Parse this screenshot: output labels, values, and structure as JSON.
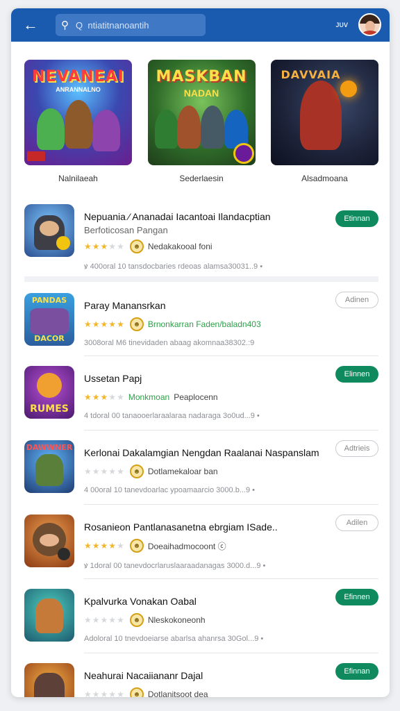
{
  "header": {
    "search_placeholder": "Q  ntiatitnanoantih",
    "user_label": "ᴊᴜᴠ",
    "colors": {
      "bar": "#1a5bb0",
      "search": "#3f78c4"
    }
  },
  "featured": [
    {
      "label": "Nalnilaeah",
      "logo": "NEVANEAI",
      "subtitle": "ANRANNALNO",
      "theme": "fantasy"
    },
    {
      "label": "Sederlaesin",
      "logo": "MASKBAN",
      "subtitle": "NADAN",
      "theme": "heroes"
    },
    {
      "label": "Alsadmoana",
      "logo": "DAVVAIA",
      "subtitle": "",
      "theme": "warrior"
    }
  ],
  "apps": [
    {
      "title": "Nepuania ⁄ Ananadai Iacantoai Ilandacptian",
      "subtitle": "Berfoticosan Pangan",
      "rating": 3,
      "developer": "Nedakakooal foni",
      "dev_color": "default",
      "info": "ꝟ 400oral 10 tansdocbaries rdeoas alamsa30031..9  •",
      "button": "Etinnan",
      "button_style": "filled"
    },
    {
      "title": "Paray Manansrkan",
      "subtitle": "",
      "rating": 5,
      "developer": "Brnonkarran Faden/baladn403",
      "dev_color": "green",
      "info": "3008oral M6 tinevidaden abaag akomnaa38302.:9",
      "button": "Adinen",
      "button_style": "outline"
    },
    {
      "title": "Ussetan Papj",
      "subtitle": "",
      "rating": 3,
      "developer": "Monkmoan",
      "dev_color": "green",
      "developer_extra": "Peaplocenn",
      "info": "4 tdoral 00 tanaooerlaraalaraa nadaraga 3o0ud...9  •",
      "button": "Elinnen",
      "button_style": "filled"
    },
    {
      "title": "Kerlonai Dakalamgian Nengdan Raalanai Naspanslam",
      "subtitle": "",
      "rating": 0,
      "developer": "Dotlamekaloar ban",
      "dev_color": "default",
      "info": "4 00oral 10 tanevdoarlac ypoamaarcio 3000.b...9  •",
      "button": "Adtrieis",
      "button_style": "outline"
    },
    {
      "title": "Rosanieon Pantlanasanetna ebrgiam ISade..",
      "subtitle": "",
      "rating": 4,
      "developer": "Doeaihadmocoont ⓒ",
      "dev_color": "default",
      "info": "ꝟ 1doral 00 tanevdocrlaruslaaraadanagas 3000.d...9  •",
      "button": "Adilen",
      "button_style": "outline"
    },
    {
      "title": "Kpalvurka Vonakan Oabal",
      "subtitle": "",
      "rating": 0,
      "developer": "Nleskokoneonh",
      "dev_color": "default",
      "info": "Adoloral 10 tnevdoeiarse abarlsa ahanrsa 30Gol...9  •",
      "button": "Efinnen",
      "button_style": "filled"
    },
    {
      "title": "Neahurai Nacaiiananr Dajal",
      "subtitle": "",
      "rating": 0,
      "developer": "Dotlanitsoot dea",
      "dev_color": "default",
      "info": "",
      "button": "Efinnan",
      "button_style": "filled"
    }
  ]
}
